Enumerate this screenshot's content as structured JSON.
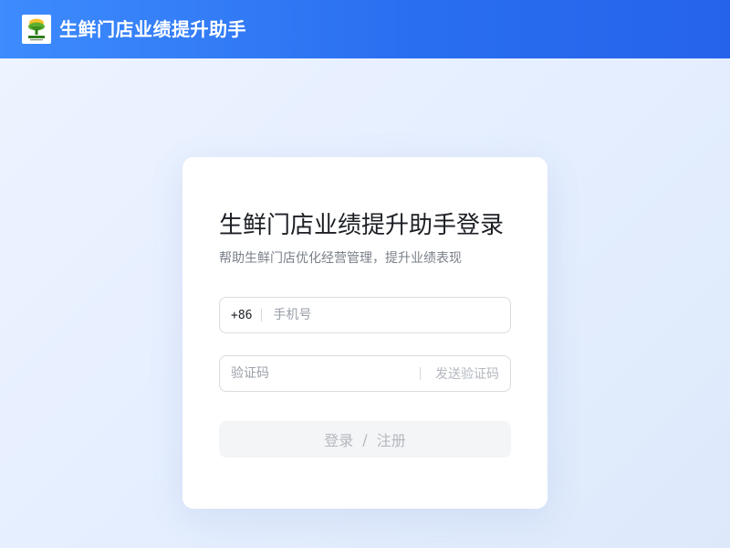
{
  "header": {
    "logo_icon": "fresh-produce-logo-icon",
    "title": "生鲜门店业绩提升助手"
  },
  "login": {
    "heading": "生鲜门店业绩提升助手登录",
    "subtitle": "帮助生鲜门店优化经营管理，提升业绩表现",
    "phone": {
      "prefix": "+86",
      "placeholder": "手机号",
      "value": ""
    },
    "code": {
      "placeholder": "验证码",
      "value": "",
      "send_label": "发送验证码"
    },
    "submit": {
      "login_label": "登录",
      "separator": "/",
      "register_label": "注册"
    }
  },
  "colors": {
    "header_start": "#3d8bfd",
    "header_end": "#2563eb",
    "page_background": "#e9f1ff",
    "card_background": "#ffffff",
    "disabled_button": "#f4f5f7",
    "disabled_text": "#b4b8be"
  }
}
